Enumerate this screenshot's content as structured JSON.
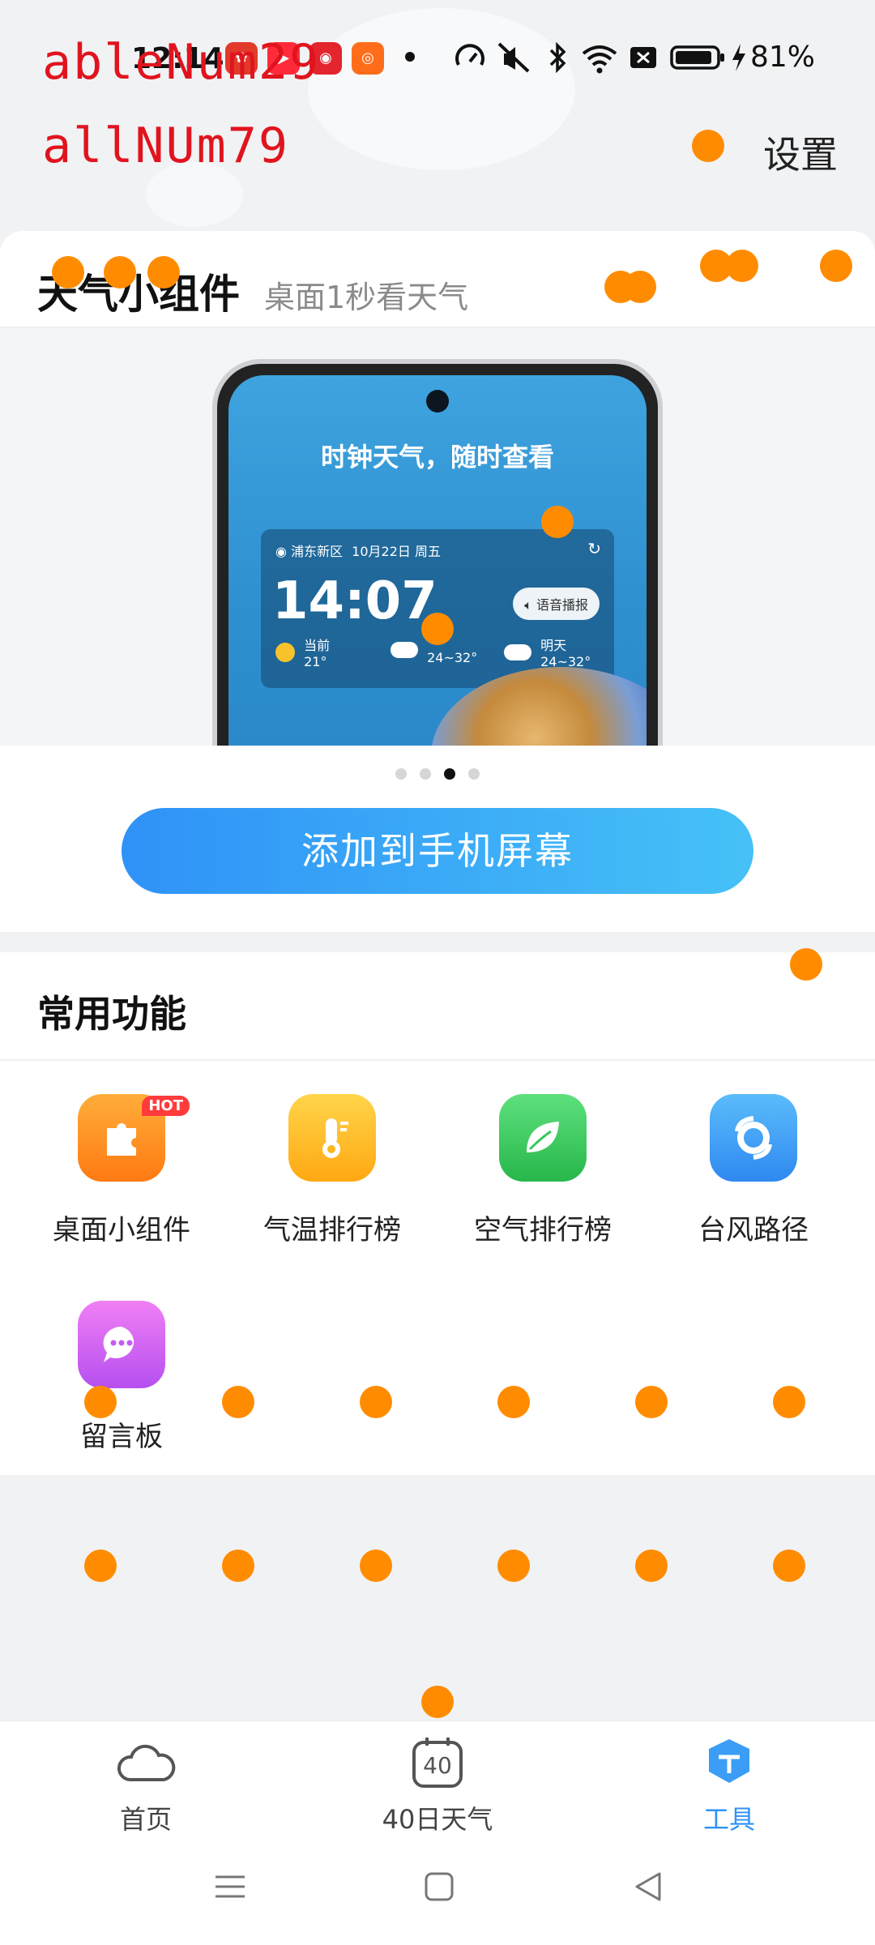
{
  "status_bar": {
    "time": "12:14",
    "battery": "81%",
    "apps": [
      "weather-app",
      "video-app",
      "news-app",
      "kuaishou-app"
    ],
    "indicator_icons": [
      "speedometer-icon",
      "mute-icon",
      "bluetooth-icon",
      "wifi-icon",
      "sim-off-icon",
      "battery-icon",
      "charging-icon"
    ]
  },
  "debug": {
    "label1": "ableNum29",
    "label2": "allNUm79"
  },
  "header": {
    "settings": "设置"
  },
  "widget_card": {
    "title": "天气小组件",
    "subtitle": "桌面1秒看天气",
    "carousel": {
      "headline": "时钟天气，随时查看",
      "widget": {
        "location": "浦东新区",
        "date": "10月22日 周五",
        "time": "14:07",
        "voice": "语音播报",
        "days": [
          {
            "label": "当前",
            "temp": "21°"
          },
          {
            "label": "",
            "temp": "24~32°"
          },
          {
            "label": "明天",
            "temp": "24~32°"
          }
        ]
      },
      "page_count": 4,
      "active_page": 3
    },
    "add_button": "添加到手机屏幕"
  },
  "functions": {
    "title": "常用功能",
    "hot_badge": "HOT",
    "items": [
      {
        "label": "桌面小组件",
        "icon": "puzzle-icon",
        "color": "#ff8a1e"
      },
      {
        "label": "气温排行榜",
        "icon": "thermometer-icon",
        "color": "#ffb81c"
      },
      {
        "label": "空气排行榜",
        "icon": "leaf-icon",
        "color": "#35c95a"
      },
      {
        "label": "台风路径",
        "icon": "typhoon-icon",
        "color": "#3b9df5"
      },
      {
        "label": "留言板",
        "icon": "chat-icon",
        "color": "#d55cf0"
      }
    ]
  },
  "bottom_nav": {
    "items": [
      {
        "label": "首页",
        "icon": "cloud-icon"
      },
      {
        "label": "40日天气",
        "icon": "calendar-40-icon",
        "icon_text": "40"
      },
      {
        "label": "工具",
        "icon": "tools-icon"
      }
    ],
    "active": 2
  },
  "colors": {
    "accent": "#2f92f7",
    "marker": "#ff8c00",
    "debug_text": "#e0141e"
  }
}
